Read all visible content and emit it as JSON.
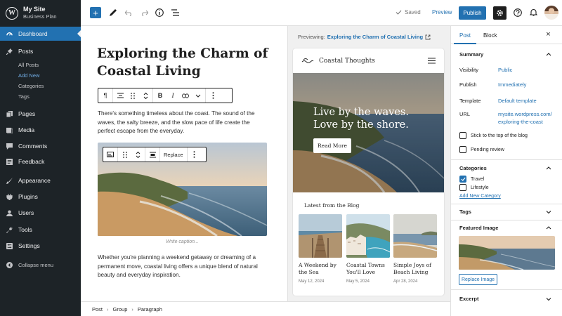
{
  "site": {
    "title": "My Site",
    "plan": "Business Plan"
  },
  "admin_menu": {
    "dashboard": "Dashboard",
    "posts": "Posts",
    "posts_sub": [
      "All Posts",
      "Add New",
      "Categories",
      "Tags"
    ],
    "pages": "Pages",
    "media": "Media",
    "comments": "Comments",
    "feedback": "Feedback",
    "appearance": "Appearance",
    "plugins": "Plugins",
    "users": "Users",
    "tools": "Tools",
    "settings": "Settings",
    "collapse": "Collapse menu"
  },
  "toolbar": {
    "saved_label": "Saved",
    "preview_label": "Preview",
    "publish_label": "Publish",
    "accent": "#2271b1"
  },
  "editor": {
    "title": "Exploring the Charm of Coastal Living",
    "paragraph_1": "There's something timeless about the coast. The sound of the waves, the salty breeze, and the slow pace of life create the perfect escape from the everyday.",
    "replace_label": "Replace",
    "caption_placeholder": "Write caption...",
    "paragraph_2": "Whether you're planning a weekend getaway or dreaming of a permanent move, coastal living offers a unique blend of natural beauty and everyday inspiration."
  },
  "preview": {
    "previewing_label": "Previewing:",
    "previewing_title": "Exploring the Charm of Coastal Living",
    "site_title": "Coastal Thoughts",
    "hero_text": "Live by the waves. Love by the shore.",
    "read_more": "Read More",
    "latest_heading": "Latest from the Blog",
    "posts": [
      {
        "title": "A Weekend by the Sea",
        "date": "May 12, 2024"
      },
      {
        "title": "Coastal Towns You'll Love",
        "date": "May 5, 2024"
      },
      {
        "title": "Simple Joys of Beach Living",
        "date": "Apr 28, 2024"
      }
    ]
  },
  "settings_panel": {
    "tabs": [
      "Post",
      "Block"
    ],
    "summary_heading": "Summary",
    "visibility_label": "Visibility",
    "visibility_value": "Public",
    "publish_label": "Publish",
    "publish_value": "Immediately",
    "template_label": "Template",
    "template_value": "Default template",
    "url_label": "URL",
    "url_value_1": "mysite.wordpress.com/",
    "url_value_2": "exploring-the-coast",
    "sticky_label": "Stick to the top of the blog",
    "pending_label": "Pending review",
    "categories_heading": "Categories",
    "categories": [
      {
        "name": "Travel",
        "checked": true
      },
      {
        "name": "Lifestyle",
        "checked": false
      }
    ],
    "add_category": "Add New Category",
    "tags_heading": "Tags",
    "featured_heading": "Featured Image",
    "replace_image": "Replace Image",
    "excerpt_heading": "Excerpt"
  },
  "breadcrumbs": [
    "Post",
    "Group",
    "Paragraph"
  ]
}
